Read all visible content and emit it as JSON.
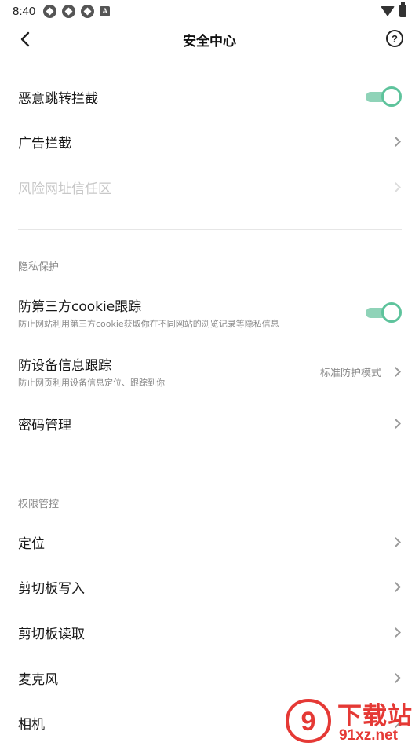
{
  "status_bar": {
    "time": "8:40",
    "notification_icons": [
      "app-icon",
      "app-icon",
      "app-icon",
      "a-icon"
    ],
    "a_glyph": "A"
  },
  "header": {
    "title": "安全中心",
    "help_glyph": "?"
  },
  "general": {
    "items": [
      {
        "label": "恶意跳转拦截",
        "control": "toggle",
        "checked": true
      },
      {
        "label": "广告拦截",
        "control": "chevron"
      },
      {
        "label": "风险网址信任区",
        "control": "chevron",
        "disabled": true
      }
    ]
  },
  "privacy": {
    "header": "隐私保护",
    "items": [
      {
        "label": "防第三方cookie跟踪",
        "subtitle": "防止网站利用第三方cookie获取你在不同网站的浏览记录等隐私信息",
        "control": "toggle",
        "checked": true
      },
      {
        "label": "防设备信息跟踪",
        "subtitle": "防止网页利用设备信息定位、跟踪到你",
        "value": "标准防护模式",
        "control": "chevron"
      },
      {
        "label": "密码管理",
        "control": "chevron"
      }
    ]
  },
  "permissions": {
    "header": "权限管控",
    "items": [
      {
        "label": "定位",
        "control": "chevron"
      },
      {
        "label": "剪切板写入",
        "control": "chevron"
      },
      {
        "label": "剪切板读取",
        "control": "chevron"
      },
      {
        "label": "麦克风",
        "control": "chevron"
      },
      {
        "label": "相机",
        "control": "chevron"
      }
    ]
  },
  "watermark": {
    "title": "下载站",
    "url": "91xz.net",
    "logo_glyph": "9"
  },
  "colors": {
    "accent": "#5ec39c",
    "accent_track": "#8fd3b8",
    "watermark": "#e53935"
  }
}
